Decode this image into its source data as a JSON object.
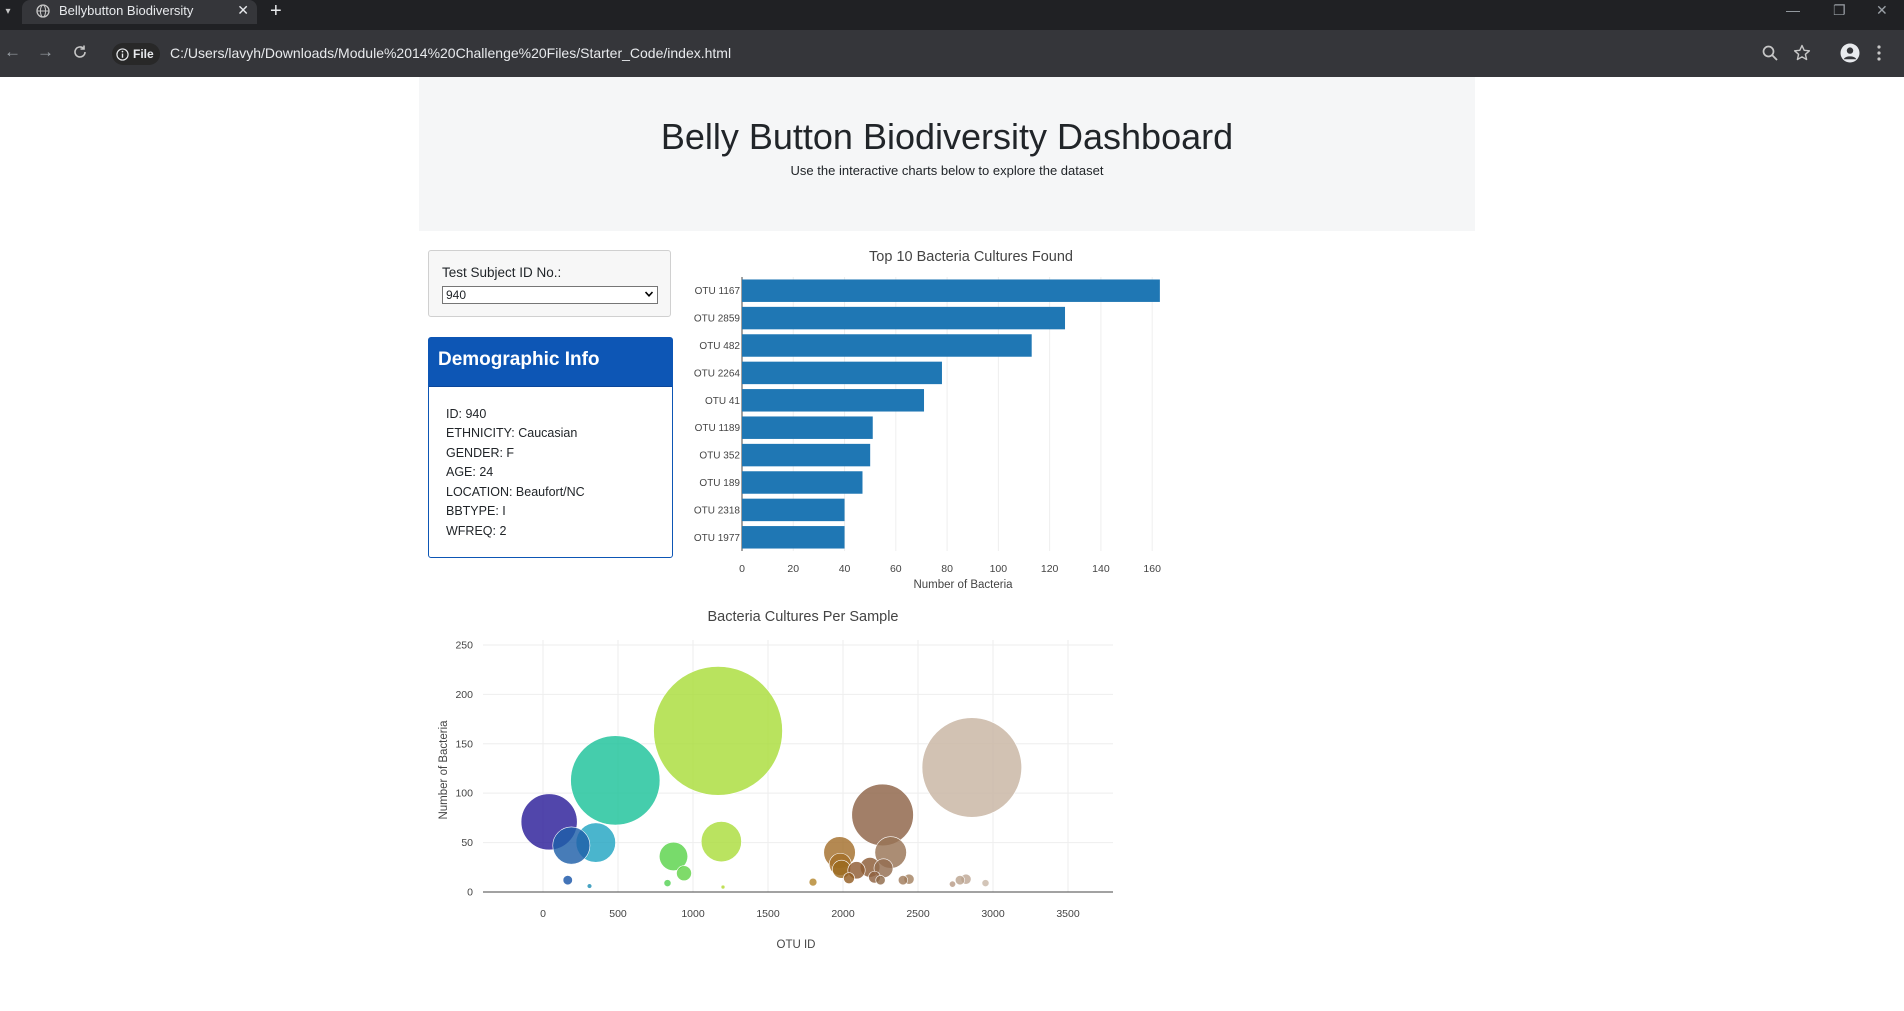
{
  "browser": {
    "tab_title": "Bellybutton Biodiversity",
    "url_chip": "File",
    "url": "C:/Users/lavyh/Downloads/Module%2014%20Challenge%20Files/Starter_Code/index.html"
  },
  "header": {
    "title": "Belly Button Biodiversity Dashboard",
    "subtitle": "Use the interactive charts below to explore the dataset"
  },
  "selector": {
    "label": "Test Subject ID No.:",
    "selected": "940"
  },
  "demographics": {
    "title": "Demographic Info",
    "rows": [
      "ID: 940",
      "ETHNICITY: Caucasian",
      "GENDER: F",
      "AGE: 24",
      "LOCATION: Beaufort/NC",
      "BBTYPE: I",
      "WFREQ: 2"
    ]
  },
  "chart_data": [
    {
      "type": "bar",
      "orientation": "horizontal",
      "title": "Top 10 Bacteria Cultures Found",
      "xlabel": "Number of Bacteria",
      "ylabel": "",
      "categories": [
        "OTU 1167",
        "OTU 2859",
        "OTU 482",
        "OTU 2264",
        "OTU 41",
        "OTU 1189",
        "OTU 352",
        "OTU 189",
        "OTU 2318",
        "OTU 1977"
      ],
      "values": [
        163,
        126,
        113,
        78,
        71,
        51,
        50,
        47,
        40,
        40
      ],
      "xlim": [
        0,
        165
      ],
      "xticks": [
        0,
        20,
        40,
        60,
        80,
        100,
        120,
        140,
        160
      ],
      "color": "#1f77b4",
      "grid": true
    },
    {
      "type": "scatter",
      "style": "bubble",
      "title": "Bacteria Cultures Per Sample",
      "xlabel": "OTU ID",
      "ylabel": "Number of Bacteria",
      "xlim": [
        -400,
        3800
      ],
      "ylim": [
        0,
        255
      ],
      "xticks": [
        0,
        500,
        1000,
        1500,
        2000,
        2500,
        3000,
        3500
      ],
      "yticks": [
        0,
        50,
        100,
        150,
        200,
        250
      ],
      "colorscale": "Earth",
      "grid": true,
      "points": [
        {
          "x": 41,
          "y": 71,
          "color": "#2b1d99"
        },
        {
          "x": 165,
          "y": 12,
          "color": "#1a56a8"
        },
        {
          "x": 189,
          "y": 47,
          "color": "#1f5fa8"
        },
        {
          "x": 310,
          "y": 6,
          "color": "#1e8fb5"
        },
        {
          "x": 352,
          "y": 50,
          "color": "#22a5c2"
        },
        {
          "x": 482,
          "y": 113,
          "color": "#1cc29a"
        },
        {
          "x": 830,
          "y": 9,
          "color": "#55d255"
        },
        {
          "x": 870,
          "y": 36,
          "color": "#5ad34a"
        },
        {
          "x": 940,
          "y": 19,
          "color": "#63d349"
        },
        {
          "x": 1167,
          "y": 163,
          "color": "#a9dd3a"
        },
        {
          "x": 1189,
          "y": 51,
          "color": "#abdd3d"
        },
        {
          "x": 1200,
          "y": 5,
          "color": "#b2d830"
        },
        {
          "x": 1800,
          "y": 10,
          "color": "#b5882e"
        },
        {
          "x": 1977,
          "y": 40,
          "color": "#a46f2c"
        },
        {
          "x": 1982,
          "y": 28,
          "color": "#a36f28"
        },
        {
          "x": 1990,
          "y": 23,
          "color": "#9b6a1e"
        },
        {
          "x": 2040,
          "y": 14,
          "color": "#925d22"
        },
        {
          "x": 2090,
          "y": 22,
          "color": "#8f5b32"
        },
        {
          "x": 2180,
          "y": 25,
          "color": "#8b5a35"
        },
        {
          "x": 2210,
          "y": 15,
          "color": "#8e6040"
        },
        {
          "x": 2250,
          "y": 12,
          "color": "#8f6a49"
        },
        {
          "x": 2264,
          "y": 78,
          "color": "#8d6347"
        },
        {
          "x": 2270,
          "y": 24,
          "color": "#946e50"
        },
        {
          "x": 2318,
          "y": 40,
          "color": "#997456"
        },
        {
          "x": 2400,
          "y": 12,
          "color": "#a07b5c"
        },
        {
          "x": 2440,
          "y": 13,
          "color": "#a58262"
        },
        {
          "x": 2730,
          "y": 8,
          "color": "#b89b86"
        },
        {
          "x": 2780,
          "y": 12,
          "color": "#bba38f"
        },
        {
          "x": 2820,
          "y": 13,
          "color": "#bea795"
        },
        {
          "x": 2859,
          "y": 126,
          "color": "#c8b4a2"
        },
        {
          "x": 2950,
          "y": 9,
          "color": "#c9b8a8"
        }
      ]
    }
  ]
}
